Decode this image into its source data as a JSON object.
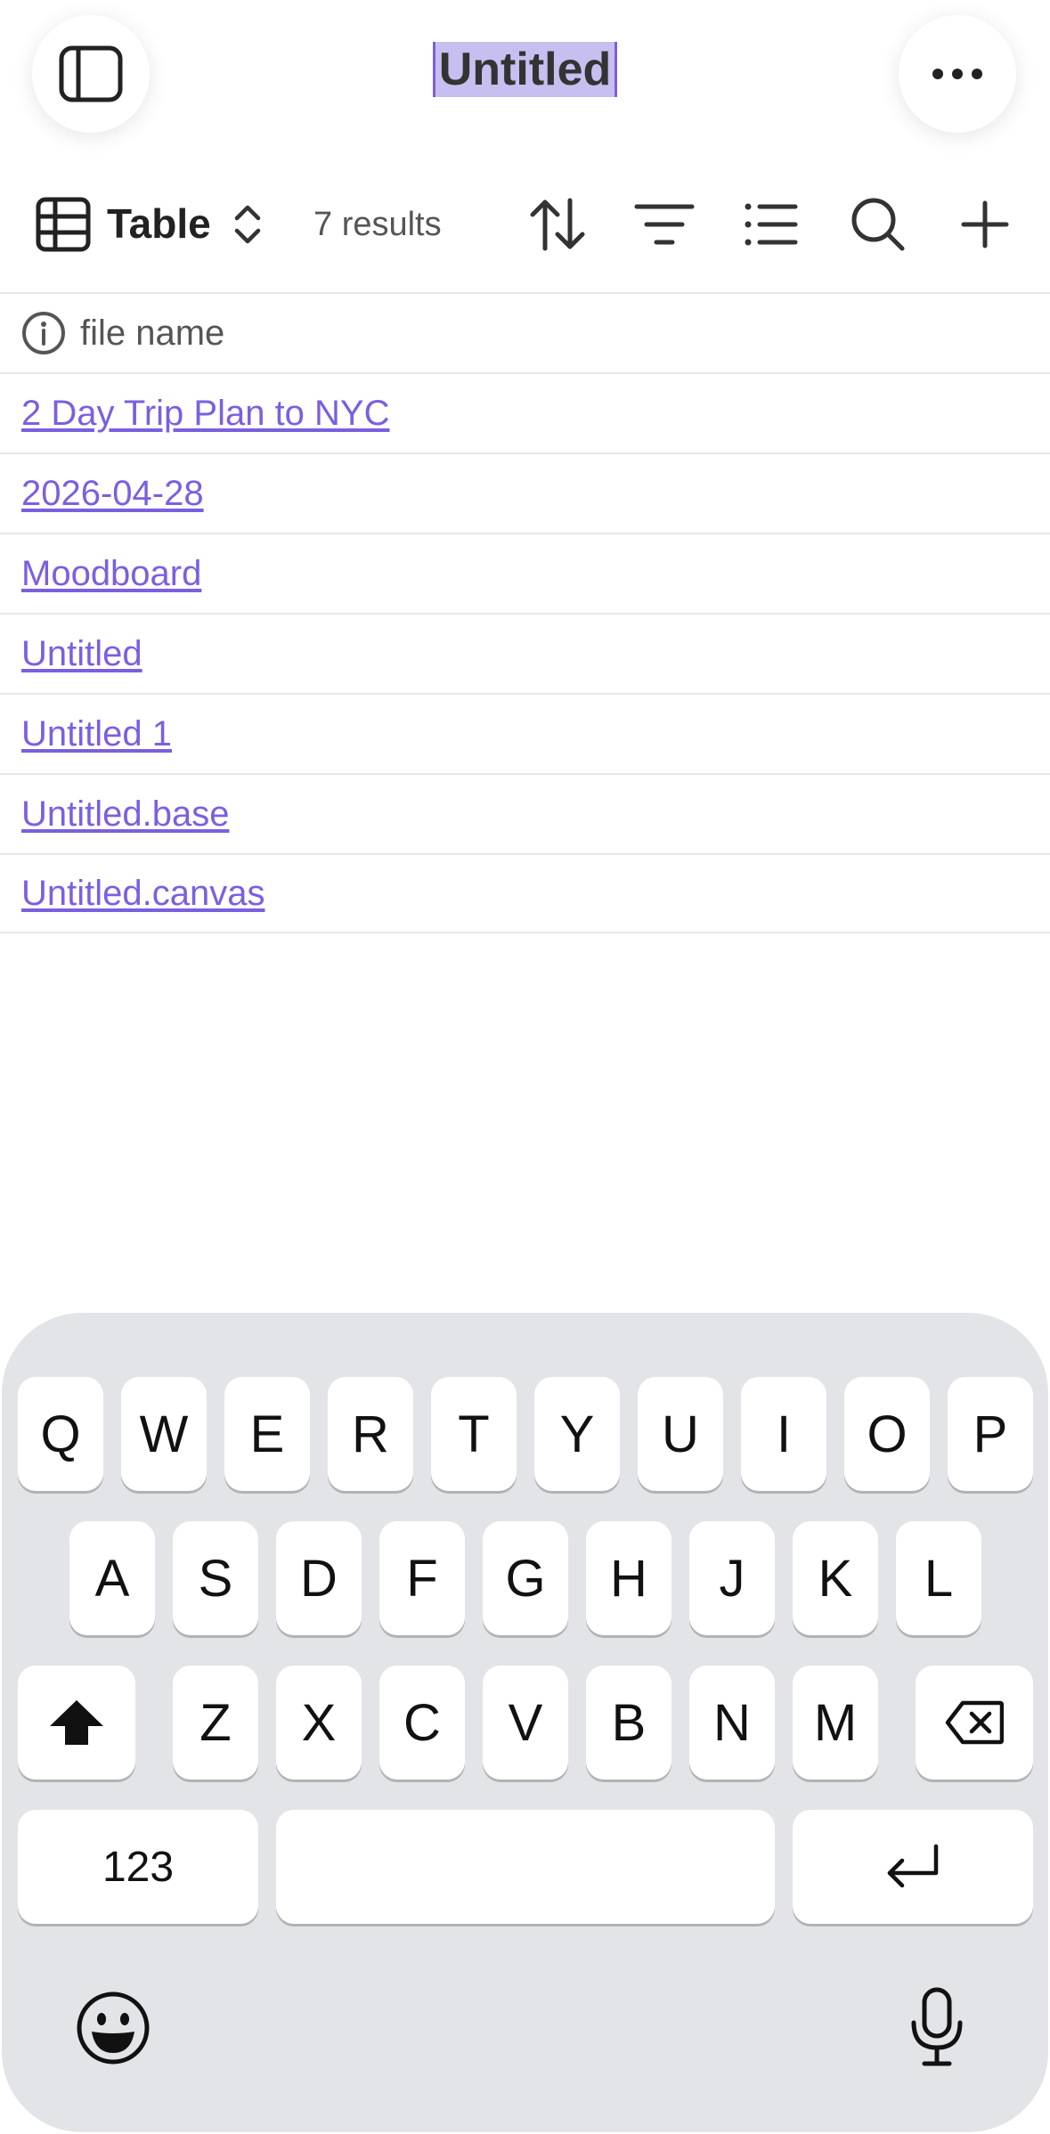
{
  "header": {
    "title": "Untitled"
  },
  "toolbar": {
    "view_label": "Table",
    "results": "7 results"
  },
  "table": {
    "column_header": "file name",
    "rows": [
      "2 Day Trip Plan to NYC",
      "2026-04-28",
      "Moodboard",
      "Untitled",
      "Untitled 1",
      "Untitled.base",
      "Untitled.canvas"
    ]
  },
  "keyboard": {
    "row1": [
      "Q",
      "W",
      "E",
      "R",
      "T",
      "Y",
      "U",
      "I",
      "O",
      "P"
    ],
    "row2": [
      "A",
      "S",
      "D",
      "F",
      "G",
      "H",
      "J",
      "K",
      "L"
    ],
    "row3": [
      "Z",
      "X",
      "C",
      "V",
      "B",
      "N",
      "M"
    ],
    "numbers_label": "123"
  },
  "colors": {
    "accent": "#7b5fe0",
    "keyboard_bg": "#e3e4e7"
  }
}
